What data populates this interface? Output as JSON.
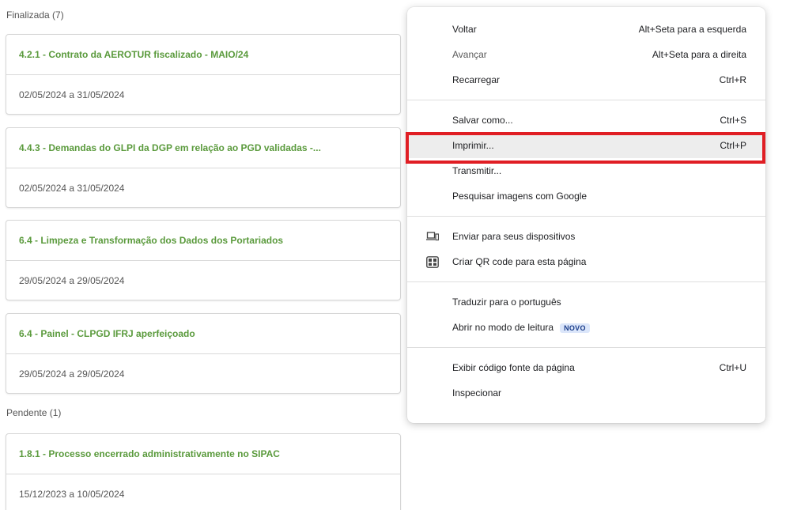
{
  "sections": [
    {
      "label": "Finalizada (7)"
    },
    {
      "label": "Pendente (1)"
    }
  ],
  "cards": [
    {
      "title": "4.2.1 - Contrato da AEROTUR fiscalizado - MAIO/24",
      "date": "02/05/2024 a 31/05/2024"
    },
    {
      "title": "4.4.3 - Demandas do GLPI da DGP em relação ao PGD validadas -...",
      "date": "02/05/2024 a 31/05/2024"
    },
    {
      "title": "6.4 - Limpeza e Transformação dos Dados dos Portariados",
      "date": "29/05/2024 a 29/05/2024"
    },
    {
      "title": "6.4 - Painel - CLPGD IFRJ aperfeiçoado",
      "date": "29/05/2024 a 29/05/2024"
    },
    {
      "title": "1.8.1 - Processo encerrado administrativamente no SIPAC",
      "date": "15/12/2023 a 10/05/2024"
    }
  ],
  "context_menu": {
    "back": {
      "label": "Voltar",
      "shortcut": "Alt+Seta para a esquerda"
    },
    "forward": {
      "label": "Avançar",
      "shortcut": "Alt+Seta para a direita"
    },
    "reload": {
      "label": "Recarregar",
      "shortcut": "Ctrl+R"
    },
    "save_as": {
      "label": "Salvar como...",
      "shortcut": "Ctrl+S"
    },
    "print": {
      "label": "Imprimir...",
      "shortcut": "Ctrl+P"
    },
    "cast": {
      "label": "Transmitir..."
    },
    "search_images": {
      "label": "Pesquisar imagens com Google"
    },
    "send_devices": {
      "label": "Enviar para seus dispositivos",
      "icon": "devices-icon"
    },
    "qr_code": {
      "label": "Criar QR code para esta página",
      "icon": "qr-code-icon"
    },
    "translate": {
      "label": "Traduzir para o português"
    },
    "reading_mode": {
      "label": "Abrir no modo de leitura",
      "badge": "NOVO"
    },
    "view_source": {
      "label": "Exibir código fonte da página",
      "shortcut": "Ctrl+U"
    },
    "inspect": {
      "label": "Inspecionar"
    }
  },
  "colors": {
    "card_title": "#5a9a3c",
    "highlight": "#e01e24",
    "badge_bg": "#dbe6fa"
  }
}
